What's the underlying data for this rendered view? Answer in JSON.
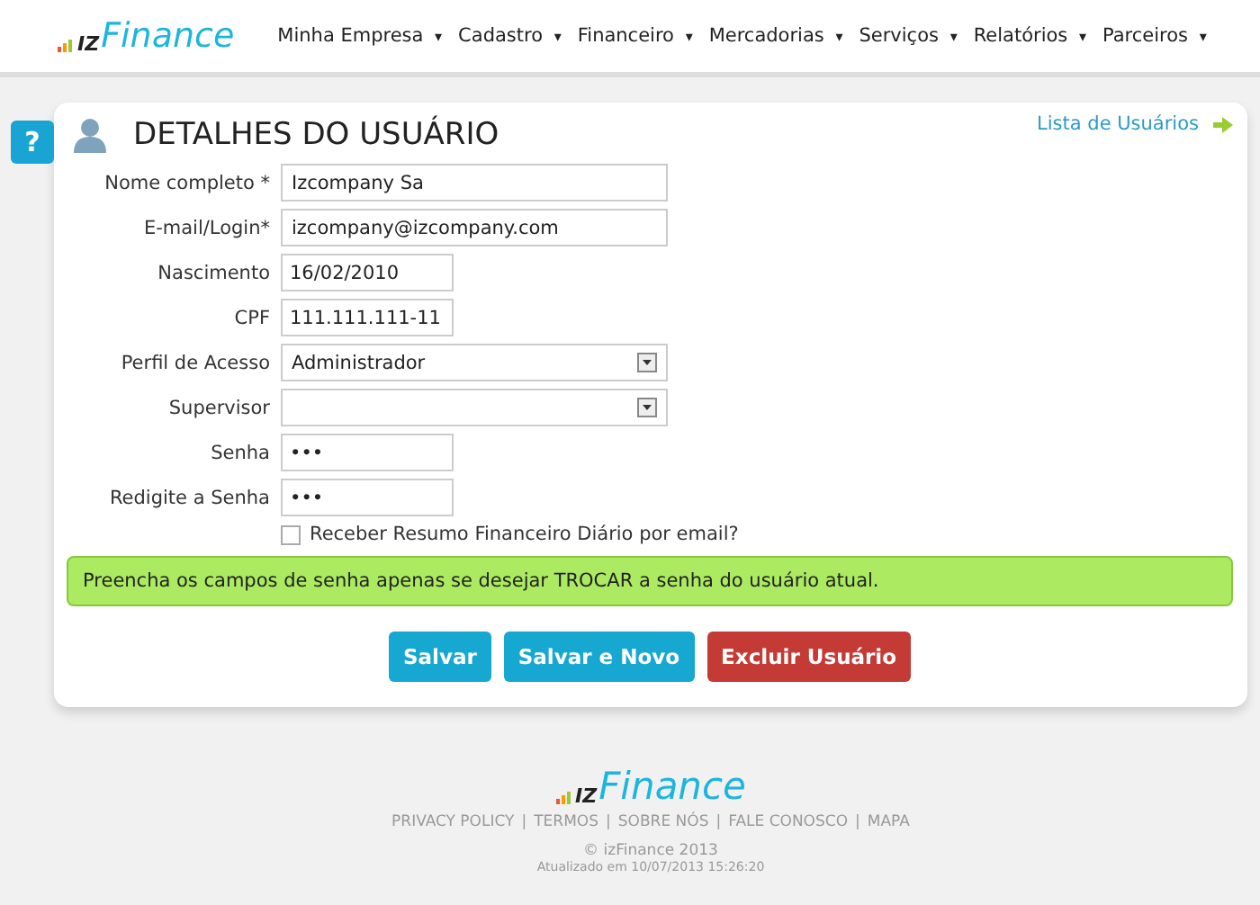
{
  "header": {
    "logo": {
      "mark": "IZ",
      "name": "Finance"
    },
    "menu": [
      {
        "label": "Minha Empresa",
        "caret": "▾"
      },
      {
        "label": "Cadastro",
        "caret": "▾"
      },
      {
        "label": "Financeiro",
        "caret": "▾"
      },
      {
        "label": "Mercadorias",
        "caret": "▾"
      },
      {
        "label": "Serviços",
        "caret": "▾"
      },
      {
        "label": "Relatórios",
        "caret": "▾"
      },
      {
        "label": "Parceiros",
        "caret": "▾"
      }
    ]
  },
  "help_button": "?",
  "page": {
    "title": "DETALHES DO USUÁRIO",
    "link": "Lista de Usuários"
  },
  "form": {
    "fields": [
      {
        "kind": "text",
        "label": "Nome completo *",
        "value": "Izcompany Sa"
      },
      {
        "kind": "text",
        "label": "E-mail/Login*",
        "value": "izcompany@izcompany.com"
      },
      {
        "kind": "short",
        "label": "Nascimento",
        "value": "16/02/2010"
      },
      {
        "kind": "short",
        "label": "CPF",
        "value": "111.111.111-11"
      },
      {
        "kind": "select",
        "label": "Perfil de Acesso",
        "value": "Administrador"
      },
      {
        "kind": "select",
        "label": "Supervisor"
      },
      {
        "kind": "short",
        "label": "Senha",
        "value": "•••"
      },
      {
        "kind": "short",
        "label": "Redigite a Senha",
        "value": "•••"
      }
    ],
    "checkbox": {
      "label": "Receber Resumo Financeiro Diário por email?",
      "checked": false
    }
  },
  "notice": "Preencha os campos de senha apenas se desejar TROCAR a senha do usuário atual.",
  "buttons": [
    {
      "label": "Salvar",
      "kind": "primary"
    },
    {
      "label": "Salvar e Novo",
      "kind": "primary"
    },
    {
      "label": "Excluir Usuário",
      "kind": "danger"
    }
  ],
  "footer": {
    "logo": {
      "mark": "IZ",
      "name": "Finance"
    },
    "links": [
      "PRIVACY POLICY",
      "TERMOS",
      "SOBRE NÓS",
      "FALE CONOSCO",
      "MAPA"
    ],
    "separator": "|",
    "copyright": "© izFinance 2013",
    "updated": "Atualizado em 10/07/2013 15:26:20"
  }
}
